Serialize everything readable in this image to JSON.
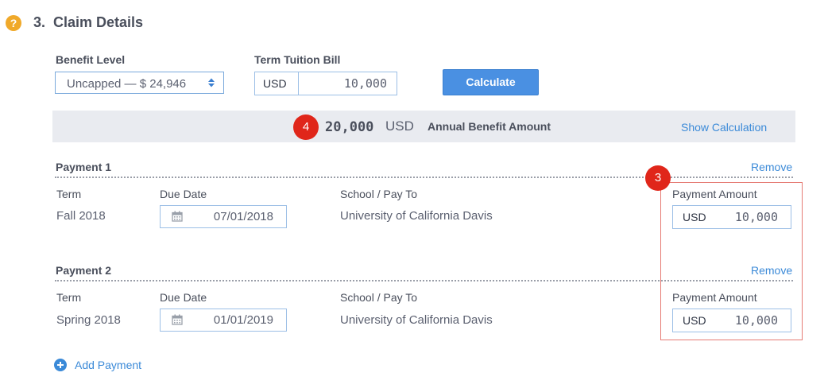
{
  "section": {
    "number_title": "3.  Claim Details",
    "help_glyph": "?"
  },
  "form": {
    "benefit_level_label": "Benefit Level",
    "benefit_level_value": "Uncapped — $ 24,946",
    "tuition_label": "Term Tuition Bill",
    "tuition_currency": "USD",
    "tuition_amount": "10,000",
    "calculate_label": "Calculate"
  },
  "annual": {
    "badge": "4",
    "amount": "20,000",
    "currency": "USD",
    "label": "Annual Benefit Amount",
    "show_calc_label": "Show Calculation"
  },
  "payment_badge": "3",
  "payments": [
    {
      "title": "Payment 1",
      "remove_label": "Remove",
      "term_label": "Term",
      "term_value": "Fall 2018",
      "due_label": "Due Date",
      "due_value": "07/01/2018",
      "school_label": "School / Pay To",
      "school_value": "University of California Davis",
      "amount_label": "Payment Amount",
      "amount_currency": "USD",
      "amount_value": "10,000"
    },
    {
      "title": "Payment 2",
      "remove_label": "Remove",
      "term_label": "Term",
      "term_value": "Spring 2018",
      "due_label": "Due Date",
      "due_value": "01/01/2019",
      "school_label": "School / Pay To",
      "school_value": "University of California Davis",
      "amount_label": "Payment Amount",
      "amount_currency": "USD",
      "amount_value": "10,000"
    }
  ],
  "add_payment_label": "Add Payment",
  "colors": {
    "accent": "#4a90e2",
    "link": "#3b8ad8",
    "badge": "#e0261a",
    "help": "#f0a92a",
    "highlight_border": "#e57b74"
  }
}
